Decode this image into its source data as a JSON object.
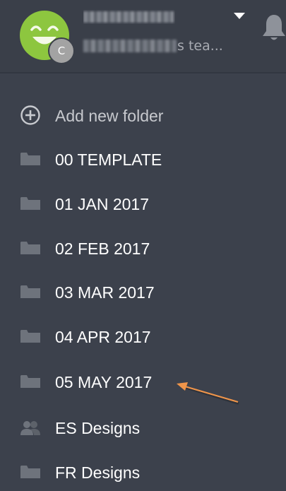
{
  "header": {
    "avatar_badge": "C",
    "team_suffix": "s tea..."
  },
  "menu": {
    "add_folder": "Add new folder",
    "items": [
      {
        "label": "00 TEMPLATE",
        "icon": "folder-icon"
      },
      {
        "label": "01 JAN 2017",
        "icon": "folder-icon"
      },
      {
        "label": "02 FEB 2017",
        "icon": "folder-icon"
      },
      {
        "label": "03 MAR 2017",
        "icon": "folder-icon"
      },
      {
        "label": "04 APR 2017",
        "icon": "folder-icon"
      },
      {
        "label": "05 MAY 2017",
        "icon": "folder-icon"
      },
      {
        "label": "ES Designs",
        "icon": "shared-folder-icon"
      },
      {
        "label": "FR Designs",
        "icon": "folder-icon"
      }
    ]
  },
  "colors": {
    "background": "#3c414c",
    "avatar": "#8dc63f",
    "arrow": "#f0954a"
  }
}
